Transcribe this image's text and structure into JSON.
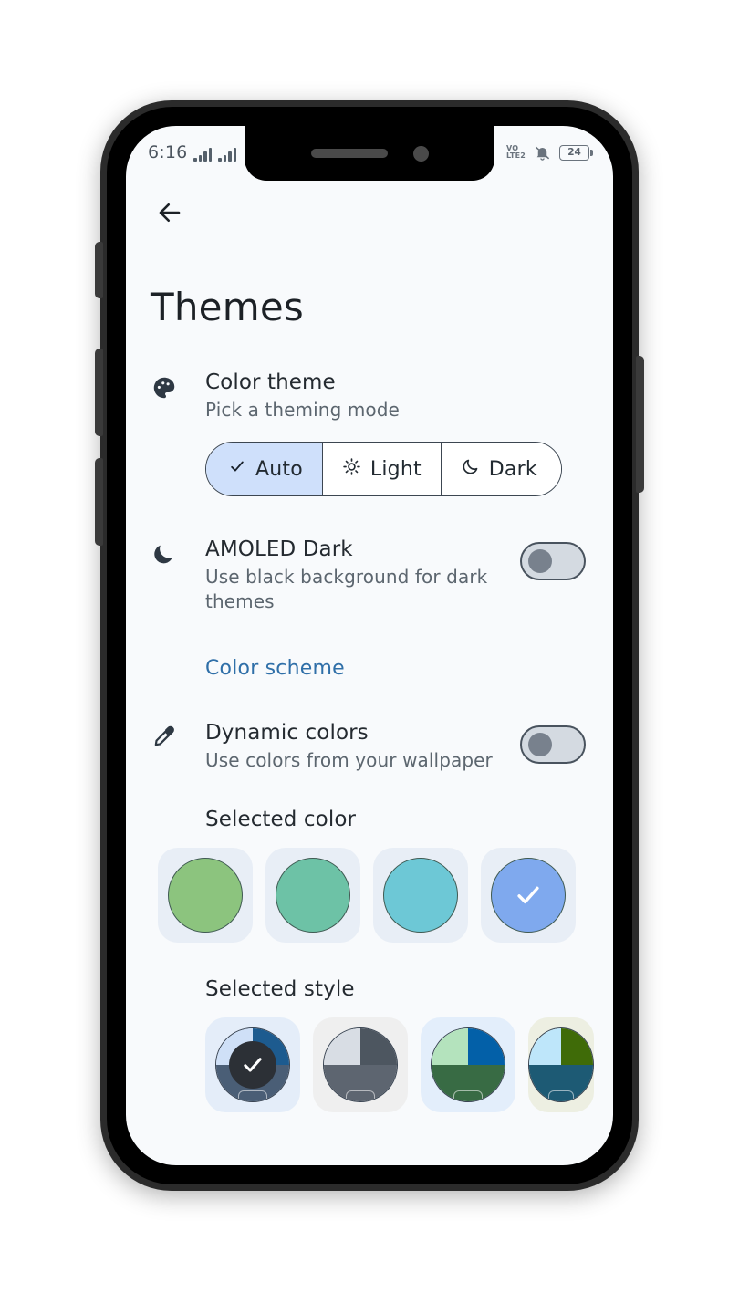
{
  "status_bar": {
    "time": "6:16",
    "network_label_top": "VO",
    "network_label_bottom": "LTE2",
    "mute_icon": "bell-muted-icon",
    "battery_level": "24",
    "signal_icon": "signal-bars-icon"
  },
  "nav": {
    "back_icon": "arrow-left-icon"
  },
  "header": {
    "title": "Themes"
  },
  "color_theme": {
    "icon": "palette-icon",
    "title": "Color theme",
    "subtitle": "Pick a theming mode",
    "options": [
      {
        "label": "Auto",
        "icon": "check-icon",
        "selected": true
      },
      {
        "label": "Light",
        "icon": "sun-icon",
        "selected": false
      },
      {
        "label": "Dark",
        "icon": "moon-icon",
        "selected": false
      }
    ]
  },
  "amoled": {
    "icon": "moon-icon",
    "title": "AMOLED Dark",
    "subtitle": "Use black background for dark themes",
    "toggle_state": "off"
  },
  "color_scheme_section": {
    "link_label": "Color scheme",
    "link_color": "#2f6fa8"
  },
  "dynamic_colors": {
    "icon": "eyedropper-icon",
    "title": "Dynamic colors",
    "subtitle": "Use colors from your wallpaper",
    "toggle_state": "off"
  },
  "selected_color": {
    "heading": "Selected color",
    "tile_bg": "#e8eef6",
    "swatches": [
      {
        "name": "green",
        "color": "#8cc47e",
        "selected": false,
        "clipped": true
      },
      {
        "name": "teal-green",
        "color": "#6dc2a6",
        "selected": false,
        "clipped": false
      },
      {
        "name": "cyan",
        "color": "#6dc8d6",
        "selected": false,
        "clipped": false
      },
      {
        "name": "blue",
        "color": "#7fa9ee",
        "selected": true,
        "clipped": false
      }
    ]
  },
  "selected_style": {
    "heading": "Selected style",
    "styles": [
      {
        "name": "tonal-spot",
        "tile_bg": "#e4edf9",
        "top_left": "#cfe0f7",
        "top_right": "#1d5b8f",
        "bottom": "#4a5e76",
        "selected": true
      },
      {
        "name": "monochrome",
        "tile_bg": "#efefef",
        "top_left": "#d8dde4",
        "top_right": "#4d5660",
        "bottom": "#5d6570",
        "selected": false
      },
      {
        "name": "vibrant",
        "tile_bg": "#e3eefb",
        "top_left": "#b4e3bd",
        "top_right": "#0360a8",
        "bottom": "#386b44",
        "selected": false
      },
      {
        "name": "expressive",
        "tile_bg": "#edefe2",
        "top_left": "#bee6fa",
        "top_right": "#3f6b08",
        "bottom": "#1d5a74",
        "selected": false
      }
    ]
  }
}
